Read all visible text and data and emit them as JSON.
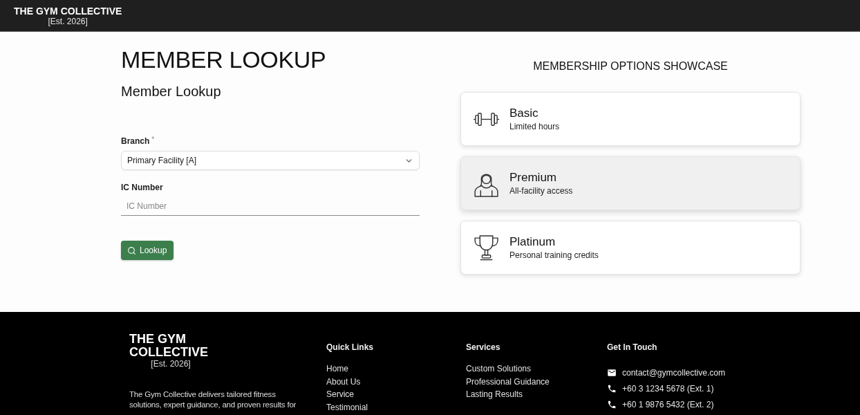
{
  "header": {
    "brand": "THE GYM COLLECTIVE",
    "established": "[Est. 2026]"
  },
  "lookup": {
    "page_title": "MEMBER LOOKUP",
    "form_title": "Member Lookup",
    "fields": [
      {
        "kind": "select",
        "label": "Branch",
        "required_mark": "*",
        "value": "Primary Facility [A]"
      },
      {
        "kind": "text",
        "label": "IC Number",
        "placeholder": "IC Number"
      }
    ],
    "button": "Lookup"
  },
  "showcase": {
    "title": "MEMBERSHIP OPTIONS SHOWCASE",
    "plans": [
      {
        "kind": "dumbbell",
        "name": "Basic",
        "description": "Limited hours",
        "selected": false
      },
      {
        "kind": "person",
        "name": "Premium",
        "description": "All-facility access",
        "selected": true
      },
      {
        "kind": "trophy",
        "name": "Platinum",
        "description": "Personal training credits",
        "selected": false
      }
    ]
  },
  "footer": {
    "brand": "THE GYM COLLECTIVE",
    "established": "[Est. 2026]",
    "description": "The Gym Collective delivers tailored fitness solutions, expert guidance, and proven results for",
    "columns": [
      {
        "heading": "Quick Links",
        "links": [
          "Home",
          "About Us",
          "Service",
          "Testimonial"
        ]
      },
      {
        "heading": "Services",
        "links": [
          "Custom Solutions",
          "Professional Guidance",
          "Lasting Results"
        ]
      }
    ],
    "contact": {
      "heading": "Get In Touch",
      "items": [
        {
          "kind": "email",
          "text": "contact@gymcollective.com"
        },
        {
          "kind": "phone",
          "text": "+60 3 1234 5678 (Ext. 1)"
        },
        {
          "kind": "phone",
          "text": "+60 1 9876 5432 (Ext. 2)"
        }
      ]
    }
  }
}
